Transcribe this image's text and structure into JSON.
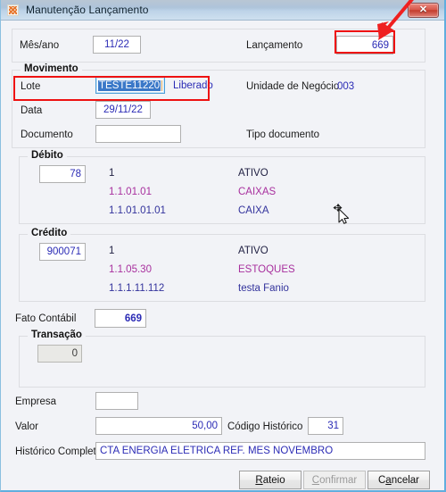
{
  "window": {
    "title": "Manutenção Lançamento",
    "app_icon": "app-icon",
    "close_label": "✕"
  },
  "header": {
    "mes_ano_label": "Mês/ano",
    "mes_ano_value": "11/22",
    "lancamento_label": "Lançamento",
    "lancamento_value": "669"
  },
  "movimento": {
    "caption": "Movimento",
    "lote_label": "Lote",
    "lote_value": "TESTE11220",
    "lote_status": "Liberado",
    "unidade_label": "Unidade de Negócio",
    "unidade_value": "003",
    "data_label": "Data",
    "data_value": "29/11/22",
    "documento_label": "Documento",
    "documento_value": "",
    "tipo_documento_label": "Tipo documento"
  },
  "debito": {
    "caption": "Débito",
    "value": "78",
    "rows": [
      {
        "code": "1",
        "desc": "ATIVO",
        "color": "c-dark"
      },
      {
        "code": "1.1.01.01",
        "desc": "CAIXAS",
        "color": "c-mag"
      },
      {
        "code": "1.1.01.01.01",
        "desc": "CAIXA",
        "color": "c-blue"
      }
    ]
  },
  "credito": {
    "caption": "Crédito",
    "value": "900071",
    "rows": [
      {
        "code": "1",
        "desc": "ATIVO",
        "color": "c-dark"
      },
      {
        "code": "1.1.05.30",
        "desc": "ESTOQUES",
        "color": "c-mag"
      },
      {
        "code": "1.1.1.11.112",
        "desc": "testa Fanio",
        "color": "c-blue"
      }
    ]
  },
  "fato": {
    "label": "Fato Contábil",
    "value": "669"
  },
  "transacao": {
    "caption": "Transação",
    "value": "0"
  },
  "footer": {
    "empresa_label": "Empresa",
    "empresa_value": "",
    "valor_label": "Valor",
    "valor_value": "50,00",
    "codigo_historico_label": "Código Histórico",
    "codigo_historico_value": "31",
    "historico_completo_label": "Histórico Completo",
    "historico_completo_value": "CTA ENERGIA ELETRICA REF. MES NOVEMBRO"
  },
  "buttons": {
    "rateio": {
      "pre": "",
      "accel": "R",
      "post": "ateio"
    },
    "confirmar": {
      "pre": "",
      "accel": "C",
      "post": "onfirmar"
    },
    "cancelar": {
      "pre": "C",
      "accel": "a",
      "post": "ncelar"
    }
  },
  "annotations": {
    "arrow_color": "#ef2020",
    "box_color": "#ee1111"
  }
}
